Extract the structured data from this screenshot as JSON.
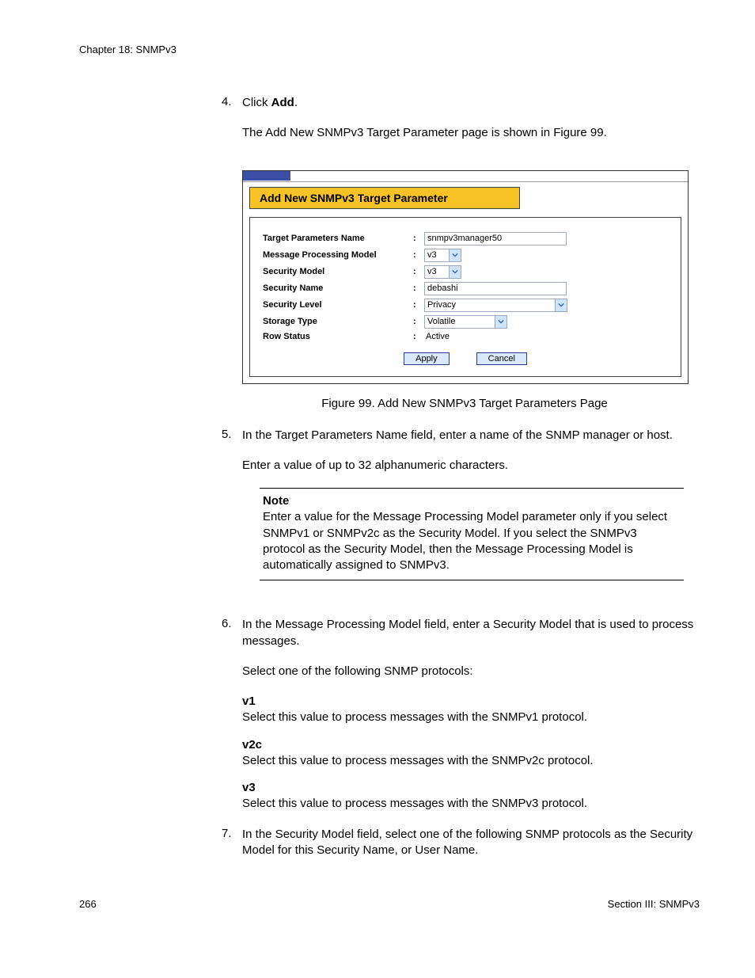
{
  "header": "Chapter 18: SNMPv3",
  "steps": {
    "s4": {
      "num": "4.",
      "textPrefix": "Click ",
      "textBold": "Add",
      "textSuffix": ".",
      "followup": "The Add New SNMPv3 Target Parameter page is shown in Figure 99."
    },
    "s5": {
      "num": "5.",
      "text": "In the Target Parameters Name field, enter a name of the SNMP manager or host.",
      "followup": "Enter a value of up to 32 alphanumeric characters."
    },
    "s6": {
      "num": "6.",
      "text": "In the Message Processing Model field, enter a Security Model that is used to process messages.",
      "followup": "Select one of the following SNMP protocols:",
      "opts": {
        "v1": {
          "label": "v1",
          "desc": "Select this value to process messages with the SNMPv1 protocol."
        },
        "v2c": {
          "label": "v2c",
          "desc": "Select this value to process messages with the SNMPv2c protocol."
        },
        "v3": {
          "label": "v3",
          "desc": "Select this value to process messages with the SNMPv3 protocol."
        }
      }
    },
    "s7": {
      "num": "7.",
      "text": "In the Security Model field, select one of the following SNMP protocols as the Security Model for this Security Name, or User Name."
    }
  },
  "figure": {
    "title": "Add New SNMPv3 Target Parameter",
    "rows": {
      "r1": {
        "label": "Target Parameters Name",
        "value": "snmpv3manager50"
      },
      "r2": {
        "label": "Message Processing Model",
        "value": "v3"
      },
      "r3": {
        "label": "Security Model",
        "value": "v3"
      },
      "r4": {
        "label": "Security Name",
        "value": "debashi"
      },
      "r5": {
        "label": "Security Level",
        "value": "Privacy"
      },
      "r6": {
        "label": "Storage Type",
        "value": "Volatile"
      },
      "r7": {
        "label": "Row Status",
        "value": "Active"
      }
    },
    "buttons": {
      "apply": "Apply",
      "cancel": "Cancel"
    },
    "caption": "Figure 99. Add New SNMPv3 Target Parameters Page"
  },
  "note": {
    "heading": "Note",
    "body": "Enter a value for the Message Processing Model parameter only if you select SNMPv1 or SNMPv2c as the Security Model. If you select the SNMPv3 protocol as the Security Model, then the Message Processing Model is automatically assigned to SNMPv3."
  },
  "footer": {
    "left": "266",
    "right": "Section III: SNMPv3"
  }
}
